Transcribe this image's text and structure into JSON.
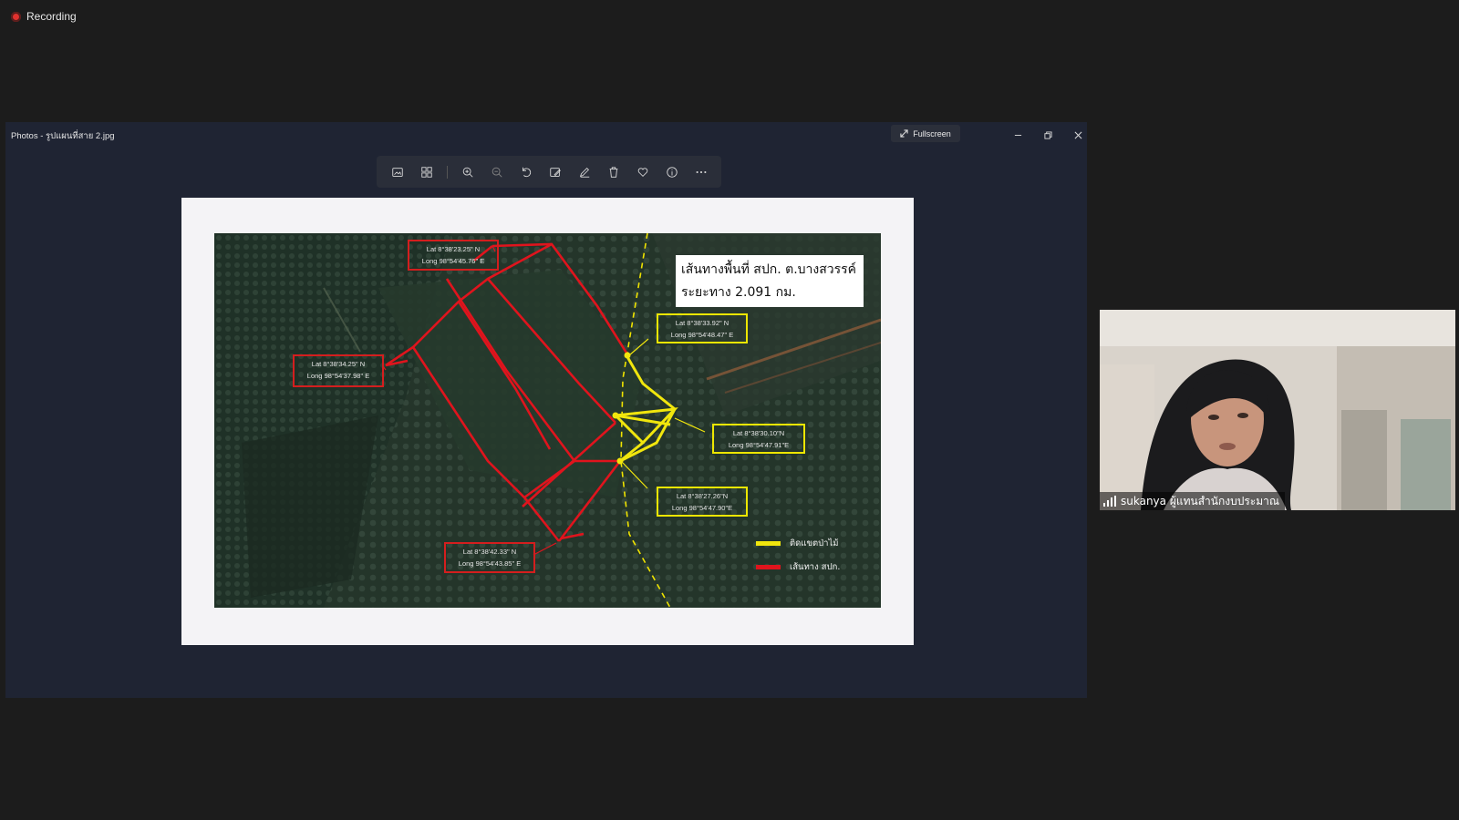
{
  "recording": {
    "label": "Recording"
  },
  "photos_window": {
    "title": "Photos - รูปแผนที่สาย 2.jpg",
    "fullscreen_label": "Fullscreen",
    "toolbar": [
      "view-icon",
      "compare-icon",
      "zoom-in-icon",
      "zoom-out-icon",
      "rotate-icon",
      "edit-icon",
      "draw-icon",
      "delete-icon",
      "favorite-icon",
      "info-icon",
      "more-icon"
    ]
  },
  "map_image": {
    "title_line1": "เส้นทางพื้นที่ สปก. ต.บางสวรรค์",
    "title_line2": "ระยะทาง 2.091 กม.",
    "red_boxes": [
      {
        "lat": "Lat  8°38'23.25\" N",
        "long": "Long 98°54'45.76\" E"
      },
      {
        "lat": "Lat  8°38'34.25\" N",
        "long": "Long 98°54'37.98\" E"
      },
      {
        "lat": "Lat  8°38'42.33\" N",
        "long": "Long  98°54'43.85\" E"
      }
    ],
    "yellow_boxes": [
      {
        "lat": "Lat  8°38'33.92\" N",
        "long": "Long  98°54'48.47\" E"
      },
      {
        "lat": "Lat  8°38'30.10\"N",
        "long": "Long  98°54'47.91\"E"
      },
      {
        "lat": "Lat  8°38'27.26\"N",
        "long": "Long  98°54'47.90\"E"
      }
    ],
    "legend": [
      {
        "label": "ติดแขตป่าไม้",
        "color": "#f1e60d"
      },
      {
        "label": "เส้นทาง สปก.",
        "color": "#e0141d"
      }
    ]
  },
  "participant": {
    "name": "sukanya ผู้แทนสำนักงบประมาณ"
  }
}
